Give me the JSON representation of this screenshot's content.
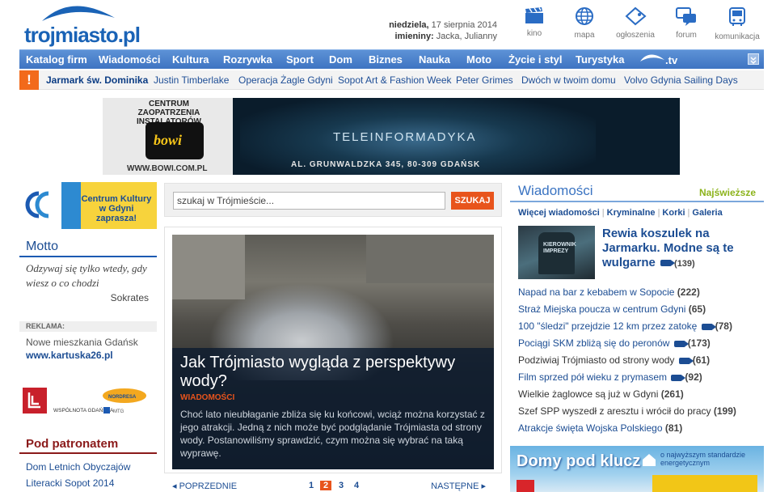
{
  "header": {
    "logo_text": "trojmiasto",
    "logo_suffix": ".pl",
    "date_day": "niedziela,",
    "date_rest": " 17 sierpnia 2014",
    "names_label": "imieniny:",
    "names_value": " Jacka, Julianny",
    "icons": [
      {
        "label": "kino",
        "icon": "clapperboard-icon"
      },
      {
        "label": "mapa",
        "icon": "globe-icon"
      },
      {
        "label": "ogłoszenia",
        "icon": "tag-icon"
      },
      {
        "label": "forum",
        "icon": "chat-bubbles-icon"
      },
      {
        "label": "komunikacja",
        "icon": "bus-icon"
      }
    ]
  },
  "nav": {
    "items": [
      "Katalog firm",
      "Wiadomości",
      "Kultura",
      "Rozrywka",
      "Sport",
      "Dom",
      "Biznes",
      "Nauka",
      "Moto",
      "Życie i styl",
      "Turystyka"
    ],
    "tv_label": ".tv"
  },
  "hotbar": {
    "items": [
      "Jarmark św. Dominika",
      "Justin Timberlake",
      "Operacja Żagle Gdyni",
      "Sopot Art & Fashion Week",
      "Peter Grimes",
      "Dwóch w twoim domu",
      "Volvo Gdynia Sailing Days"
    ],
    "badge": "!"
  },
  "banner": {
    "left_title": "CENTRUM ZAOPATRZENIA INSTALATORÓW",
    "brand": "bowi",
    "url": "WWW.BOWI.COM.PL",
    "center_text": "TELEINFORMADYKA",
    "address": "AL. GRUNWALDZKA 345, 80-309 GDAŃSK"
  },
  "left": {
    "kcg_text": "Centrum Kultury w Gdyni zaprasza!",
    "motto_title": "Motto",
    "motto_quote": "Odzywaj się tylko wtedy, gdy wiesz o co chodzi",
    "motto_author": "Sokrates",
    "reklama_label": "REKLAMA:",
    "ad_text": "Nowe mieszkania Gdańsk",
    "ad_link": "www.kartuska26.pl",
    "partner1": "WSPÓLNOTA GDAŃSKA",
    "partner2": "NORDRESA",
    "partner3": "MTG",
    "patronat_title": "Pod patronatem",
    "patronat_items": [
      "Dom Letnich Obyczajów",
      "Literacki Sopot 2014"
    ]
  },
  "center": {
    "search_placeholder": "szukaj w Trójmieście...",
    "search_button": "SZUKAJ",
    "feature_title": "Jak Trójmiasto wygląda z perspektywy wody?",
    "feature_category": "WIADOMOŚCI",
    "feature_lead": "Choć lato nieubłaganie zbliża się ku końcowi, wciąż można korzystać z jego atrakcji. Jedną z nich może być podglądanie Trójmiasta od strony wody. Postanowiliśmy sprawdzić, czym można się wybrać na taką wyprawę.",
    "pager_prev": "◂ POPRZEDNIE",
    "pager_next": "NASTĘPNE ▸",
    "pages": [
      "1",
      "2",
      "3",
      "4"
    ],
    "active_page": "2"
  },
  "right": {
    "title": "Wiadomości",
    "newest": "Najświeższe",
    "sublinks": [
      "Więcej wiadomości",
      "Kryminalne",
      "Korki",
      "Galeria"
    ],
    "thumb_text": "KIEROWNIK IMPREZY",
    "top_story": "Rewia koszulek na Jarmarku. Modne są te wulgarne",
    "top_story_count": "(139)",
    "news": [
      {
        "text": "Napad na bar z kebabem w Sopocie",
        "count": "(222)",
        "video": false,
        "dark": false
      },
      {
        "text": "Straż Miejska poucza w centrum Gdyni",
        "count": "(65)",
        "video": false,
        "dark": false
      },
      {
        "text": "100 \"śledzi\" przejdzie 12 km przez zatokę",
        "count": "(78)",
        "video": true,
        "dark": false
      },
      {
        "text": "Pociągi SKM zbliżą się do peronów",
        "count": "(173)",
        "video": true,
        "dark": false
      },
      {
        "text": "Podziwiaj Trójmiasto od strony wody",
        "count": "(61)",
        "video": true,
        "dark": true
      },
      {
        "text": "Film sprzed pół wieku z prymasem",
        "count": "(92)",
        "video": true,
        "dark": false
      },
      {
        "text": "Wielkie żaglowce są już w Gdyni",
        "count": "(261)",
        "video": false,
        "dark": true
      },
      {
        "text": "Szef SPP wyszedł z aresztu i wrócił do pracy",
        "count": "(199)",
        "video": false,
        "dark": true
      },
      {
        "text": "Atrakcje święta Wojska Polskiego",
        "count": "(81)",
        "video": false,
        "dark": false
      }
    ],
    "dom_banner_big": "Domy pod klucz",
    "dom_banner_small": "o najwyższym standardzie energetycznym"
  }
}
